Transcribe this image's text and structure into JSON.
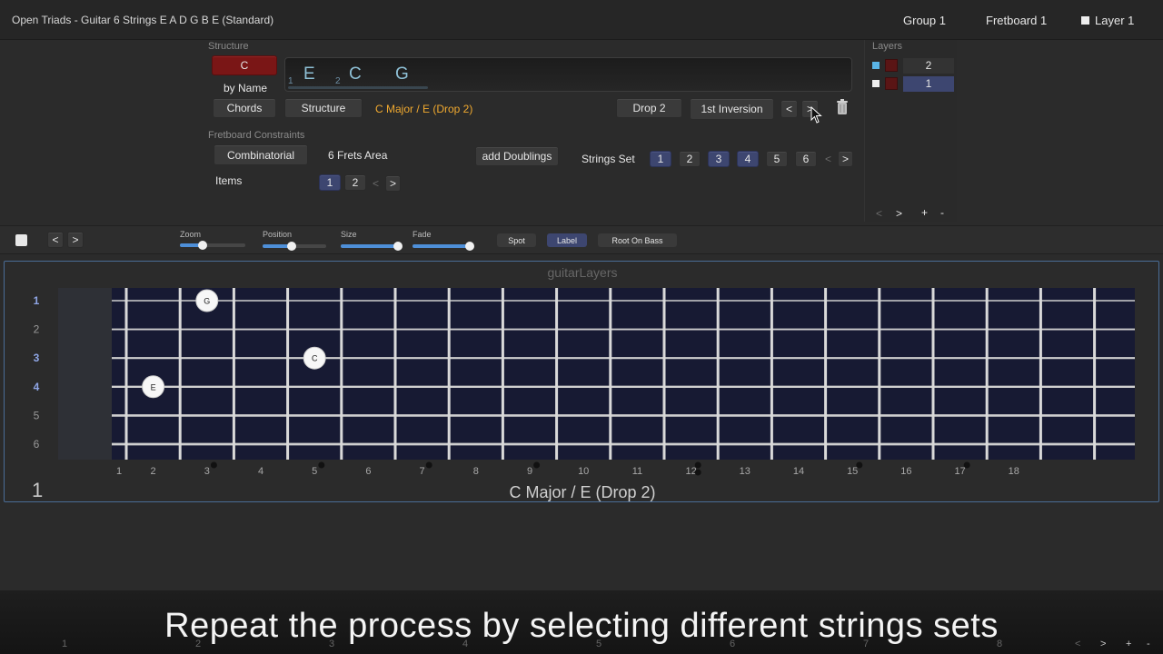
{
  "window": {
    "title": "Open Triads - Guitar 6 Strings E A D G B E (Standard)",
    "group": "Group 1",
    "fretboard": "Fretboard 1",
    "layer": "Layer 1"
  },
  "structure": {
    "section_label": "Structure",
    "root_note": "C",
    "by_name_label": "by Name",
    "chords_button": "Chords",
    "structure_button": "Structure",
    "chord_name": "C Major / E (Drop 2)",
    "drop_button": "Drop 2",
    "inversion_button": "1st  Inversion",
    "prev_label": "<",
    "next_label": ">",
    "notes": [
      {
        "index": "1",
        "note": "E"
      },
      {
        "index": "2",
        "note": "C"
      },
      {
        "index": "",
        "note": "G"
      }
    ]
  },
  "constraints": {
    "section_label": "Fretboard Constraints",
    "combinatorial_button": "Combinatorial",
    "frets_area": "6 Frets Area",
    "add_doublings_button": "add Doublings",
    "strings_set_label": "Strings Set",
    "strings_set": [
      {
        "label": "1",
        "selected": true
      },
      {
        "label": "2",
        "selected": false
      },
      {
        "label": "3",
        "selected": true
      },
      {
        "label": "4",
        "selected": true
      },
      {
        "label": "5",
        "selected": false
      },
      {
        "label": "6",
        "selected": false
      }
    ],
    "items_label": "Items",
    "items": [
      {
        "label": "1",
        "selected": true
      },
      {
        "label": "2",
        "selected": false
      }
    ],
    "prev_label": "<",
    "next_label": ">"
  },
  "layers": {
    "section_label": "Layers",
    "rows": [
      {
        "label": "2",
        "color": "#5ab4e6",
        "selected": false
      },
      {
        "label": "1",
        "color": "#eeeeee",
        "selected": true
      }
    ],
    "footer": {
      "prev": "<",
      "next": ">",
      "add": "+",
      "remove": "-"
    }
  },
  "toolbar": {
    "prev": "<",
    "next": ">",
    "sliders": [
      {
        "label": "Zoom",
        "value": 0.35
      },
      {
        "label": "Position",
        "value": 0.45
      },
      {
        "label": "Size",
        "value": 1.0
      },
      {
        "label": "Fade",
        "value": 1.0
      }
    ],
    "buttons": [
      {
        "label": "Spot",
        "selected": false
      },
      {
        "label": "Label",
        "selected": true
      },
      {
        "label": "Root On Bass",
        "selected": false
      }
    ]
  },
  "fretboard": {
    "caption": "guitarLayers",
    "layer_number": "1",
    "chord_title": "C Major / E (Drop 2)",
    "string_labels": [
      "1",
      "2",
      "3",
      "4",
      "5",
      "6"
    ],
    "highlighted_strings": [
      1,
      3,
      4
    ],
    "fret_numbers": [
      "1",
      "2",
      "3",
      "4",
      "5",
      "6",
      "7",
      "8",
      "9",
      "10",
      "11",
      "12",
      "13",
      "14",
      "15",
      "16",
      "17",
      "18"
    ],
    "inlay_frets": [
      3,
      5,
      7,
      9,
      15,
      17
    ],
    "double_inlay_frets": [
      12
    ],
    "notes": [
      {
        "string": 1,
        "fret": 3,
        "label": "G"
      },
      {
        "string": 3,
        "fret": 5,
        "label": "C"
      },
      {
        "string": 4,
        "fret": 2,
        "label": "E"
      }
    ],
    "colors": {
      "board": "#171a33",
      "string": "#cfcfcf",
      "fret": "#d9d9d9",
      "accent": "#4e8fd8"
    }
  },
  "caption": {
    "text": "Repeat the process by selecting different strings sets"
  },
  "bottom_numbers": [
    "1",
    "2",
    "3",
    "4",
    "5",
    "6",
    "7",
    "8"
  ],
  "bottom_nav": {
    "prev": "<",
    "next": ">",
    "add": "+",
    "remove": "-"
  }
}
